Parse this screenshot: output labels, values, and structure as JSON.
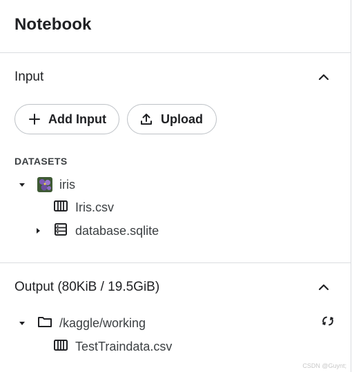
{
  "panel": {
    "title": "Notebook"
  },
  "input": {
    "heading": "Input",
    "add_input_label": "Add Input",
    "upload_label": "Upload",
    "datasets_caption": "DATASETS",
    "datasets": [
      {
        "name": "iris",
        "expanded": true,
        "files": [
          {
            "name": "Iris.csv",
            "icon": "table-icon"
          },
          {
            "name": "database.sqlite",
            "icon": "database-icon",
            "expandable": true
          }
        ]
      }
    ]
  },
  "output": {
    "heading": "Output (80KiB / 19.5GiB)",
    "folder": "/kaggle/working",
    "files": [
      {
        "name": "TestTraindata.csv",
        "icon": "table-icon"
      }
    ]
  },
  "watermark": "CSDN @Guynt;",
  "colors": {
    "text": "#202124",
    "border": "#dadce0",
    "button_border": "#bdc1c6",
    "thumbnail": "#6b4fa0"
  }
}
